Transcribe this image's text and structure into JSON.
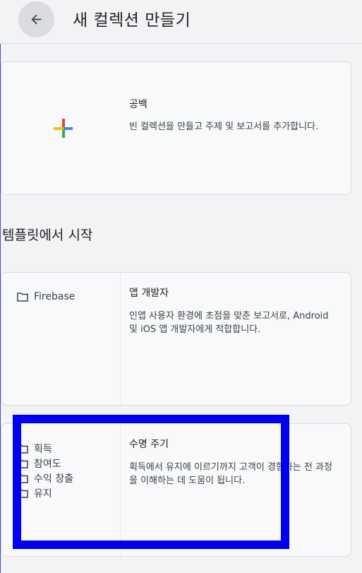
{
  "header": {
    "title": "새 컬렉션 만들기"
  },
  "blank_card": {
    "title": "공백",
    "description": "빈 컬렉션을 만들고 주제 및 보고서를 추가합니다."
  },
  "templates_section": {
    "title": "템플릿에서 시작",
    "cards": [
      {
        "folders": [
          "Firebase"
        ],
        "title": "앱 개발자",
        "description": "인앱 사용자 환경에 초점을 맞춘 보고서로, Android 및 iOS 앱 개발자에게 적합합니다."
      },
      {
        "folders": [
          "획득",
          "참여도",
          "수익 창출",
          "유지"
        ],
        "title": "수명 주기",
        "description": "획득에서 유지에 이르기까지 고객이 경험하는 전 과정을 이해하는 데 도움이 됩니다."
      }
    ]
  },
  "colors": {
    "highlight": "#0000ee",
    "plus_blue": "#4285f4",
    "plus_red": "#ea4335",
    "plus_yellow": "#fbbc04",
    "plus_green": "#34a853"
  },
  "icons": {
    "back": "arrow-back-icon",
    "add": "plus-icon",
    "folder": "folder-icon"
  }
}
